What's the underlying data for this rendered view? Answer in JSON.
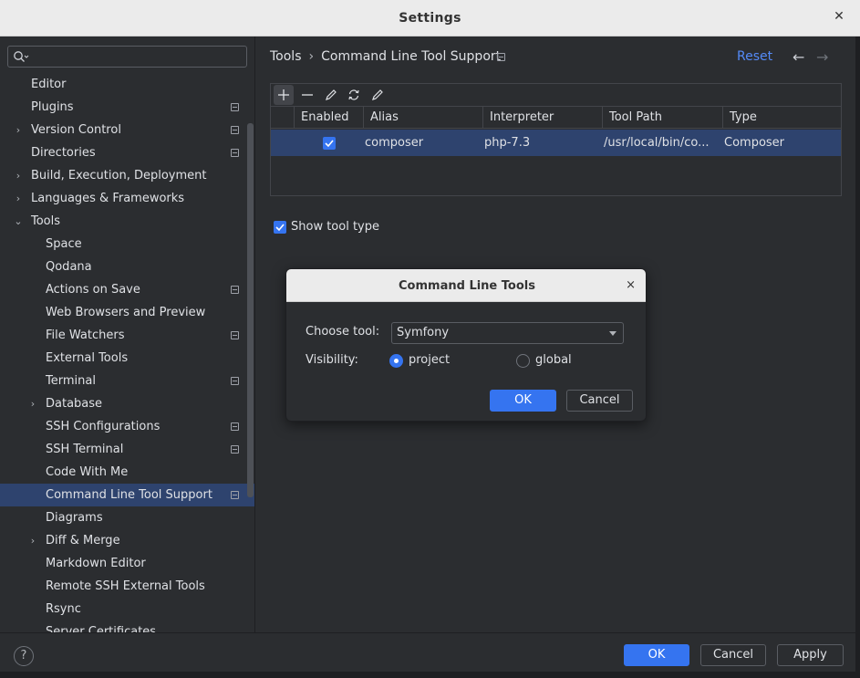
{
  "window": {
    "title": "Settings"
  },
  "search": {
    "placeholder": ""
  },
  "sidebar": {
    "items": [
      {
        "label": "Editor",
        "level": 0,
        "arrow": "",
        "proj": false
      },
      {
        "label": "Plugins",
        "level": 0,
        "arrow": "",
        "proj": true
      },
      {
        "label": "Version Control",
        "level": 0,
        "arrow": "›",
        "proj": true
      },
      {
        "label": "Directories",
        "level": 0,
        "arrow": "",
        "proj": true
      },
      {
        "label": "Build, Execution, Deployment",
        "level": 0,
        "arrow": "›",
        "proj": false
      },
      {
        "label": "Languages & Frameworks",
        "level": 0,
        "arrow": "›",
        "proj": false
      },
      {
        "label": "Tools",
        "level": 0,
        "arrow": "⌄",
        "proj": false
      },
      {
        "label": "Space",
        "level": 1,
        "arrow": "",
        "proj": false
      },
      {
        "label": "Qodana",
        "level": 1,
        "arrow": "",
        "proj": false
      },
      {
        "label": "Actions on Save",
        "level": 1,
        "arrow": "",
        "proj": true
      },
      {
        "label": "Web Browsers and Preview",
        "level": 1,
        "arrow": "",
        "proj": false
      },
      {
        "label": "File Watchers",
        "level": 1,
        "arrow": "",
        "proj": true
      },
      {
        "label": "External Tools",
        "level": 1,
        "arrow": "",
        "proj": false
      },
      {
        "label": "Terminal",
        "level": 1,
        "arrow": "",
        "proj": true
      },
      {
        "label": "Database",
        "level": 1,
        "arrow": "›",
        "proj": false
      },
      {
        "label": "SSH Configurations",
        "level": 1,
        "arrow": "",
        "proj": true
      },
      {
        "label": "SSH Terminal",
        "level": 1,
        "arrow": "",
        "proj": true
      },
      {
        "label": "Code With Me",
        "level": 1,
        "arrow": "",
        "proj": false
      },
      {
        "label": "Command Line Tool Support",
        "level": 1,
        "arrow": "",
        "proj": true,
        "selected": true
      },
      {
        "label": "Diagrams",
        "level": 1,
        "arrow": "",
        "proj": false
      },
      {
        "label": "Diff & Merge",
        "level": 1,
        "arrow": "›",
        "proj": false
      },
      {
        "label": "Markdown Editor",
        "level": 1,
        "arrow": "",
        "proj": false
      },
      {
        "label": "Remote SSH External Tools",
        "level": 1,
        "arrow": "",
        "proj": false
      },
      {
        "label": "Rsync",
        "level": 1,
        "arrow": "",
        "proj": false
      },
      {
        "label": "Server Certificates",
        "level": 1,
        "arrow": "",
        "proj": false
      }
    ]
  },
  "breadcrumb": {
    "parent": "Tools",
    "separator": "›",
    "current": "Command Line Tool Support"
  },
  "header": {
    "reset": "Reset",
    "back_icon": "←",
    "forward_icon": "→"
  },
  "table": {
    "columns": [
      "Enabled",
      "Alias",
      "Interpreter",
      "Tool Path",
      "Type"
    ],
    "rows": [
      {
        "enabled": true,
        "alias": "composer",
        "interpreter": "php-7.3",
        "tool_path": "/usr/local/bin/co...",
        "type": "Composer"
      }
    ]
  },
  "options": {
    "show_tool_type": "Show tool type",
    "show_tool_type_checked": true
  },
  "dialog": {
    "title": "Command Line Tools",
    "close": "×",
    "choose_tool_label": "Choose tool:",
    "choose_tool_value": "Symfony",
    "visibility_label": "Visibility:",
    "radio_project": "project",
    "radio_global": "global",
    "ok": "OK",
    "cancel": "Cancel"
  },
  "footer": {
    "help": "?",
    "ok": "OK",
    "cancel": "Cancel",
    "apply": "Apply"
  },
  "colors": {
    "accent": "#3574f0",
    "selection": "#2e436e",
    "link": "#548af7",
    "background": "#2b2d30"
  }
}
